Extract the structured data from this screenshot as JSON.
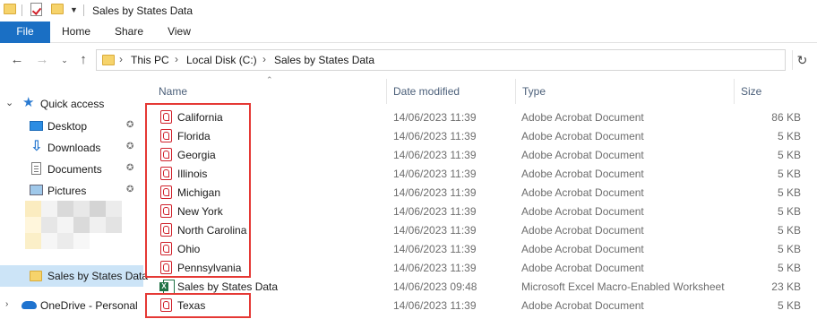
{
  "window": {
    "title": "Sales by States Data"
  },
  "ribbon": {
    "tabs": [
      "File",
      "Home",
      "Share",
      "View"
    ]
  },
  "addressbar": {
    "segments": [
      "This PC",
      "Local Disk (C:)",
      "Sales by States Data"
    ]
  },
  "sidebar": {
    "quick_access": "Quick access",
    "items": [
      {
        "label": "Desktop",
        "icon": "desktop-icon",
        "pinned": true
      },
      {
        "label": "Downloads",
        "icon": "downloads-icon",
        "pinned": true
      },
      {
        "label": "Documents",
        "icon": "documents-icon",
        "pinned": true
      },
      {
        "label": "Pictures",
        "icon": "pictures-icon",
        "pinned": true
      }
    ],
    "selected_folder": "Sales by States Data",
    "onedrive": "OneDrive - Personal"
  },
  "columns": {
    "name": "Name",
    "date": "Date modified",
    "type": "Type",
    "size": "Size"
  },
  "files": [
    {
      "name": "California",
      "date": "14/06/2023 11:39",
      "type": "Adobe Acrobat Document",
      "size": "86 KB",
      "icon": "pdf"
    },
    {
      "name": "Florida",
      "date": "14/06/2023 11:39",
      "type": "Adobe Acrobat Document",
      "size": "5 KB",
      "icon": "pdf"
    },
    {
      "name": "Georgia",
      "date": "14/06/2023 11:39",
      "type": "Adobe Acrobat Document",
      "size": "5 KB",
      "icon": "pdf"
    },
    {
      "name": "Illinois",
      "date": "14/06/2023 11:39",
      "type": "Adobe Acrobat Document",
      "size": "5 KB",
      "icon": "pdf"
    },
    {
      "name": "Michigan",
      "date": "14/06/2023 11:39",
      "type": "Adobe Acrobat Document",
      "size": "5 KB",
      "icon": "pdf"
    },
    {
      "name": "New York",
      "date": "14/06/2023 11:39",
      "type": "Adobe Acrobat Document",
      "size": "5 KB",
      "icon": "pdf"
    },
    {
      "name": "North Carolina",
      "date": "14/06/2023 11:39",
      "type": "Adobe Acrobat Document",
      "size": "5 KB",
      "icon": "pdf"
    },
    {
      "name": "Ohio",
      "date": "14/06/2023 11:39",
      "type": "Adobe Acrobat Document",
      "size": "5 KB",
      "icon": "pdf"
    },
    {
      "name": "Pennsylvania",
      "date": "14/06/2023 11:39",
      "type": "Adobe Acrobat Document",
      "size": "5 KB",
      "icon": "pdf"
    },
    {
      "name": "Sales by States Data",
      "date": "14/06/2023 09:48",
      "type": "Microsoft Excel Macro-Enabled Worksheet",
      "size": "23 KB",
      "icon": "xlsm"
    },
    {
      "name": "Texas",
      "date": "14/06/2023 11:39",
      "type": "Adobe Acrobat Document",
      "size": "5 KB",
      "icon": "pdf"
    }
  ],
  "colors": {
    "accent": "#1a6fc4",
    "highlight": "#e53935",
    "selected": "#cce4f7"
  }
}
